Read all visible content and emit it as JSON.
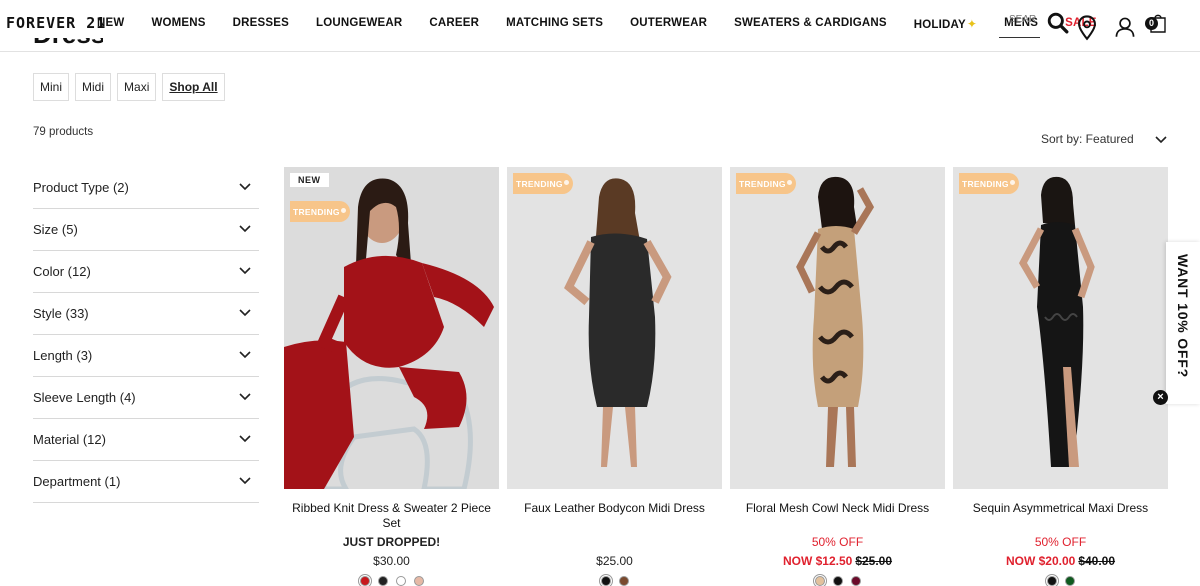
{
  "header": {
    "logo": "FOREVER 21",
    "nav": [
      {
        "label": "NEW"
      },
      {
        "label": "WOMENS"
      },
      {
        "label": "DRESSES"
      },
      {
        "label": "LOUNGEWEAR"
      },
      {
        "label": "CAREER"
      },
      {
        "label": "MATCHING SETS"
      },
      {
        "label": "OUTERWEAR"
      },
      {
        "label": "SWEATERS & CARDIGANS"
      },
      {
        "label": "HOLIDAY"
      },
      {
        "label": "MENS"
      },
      {
        "label": "SALE"
      }
    ],
    "search_placeholder": "SEAR",
    "cart_count": "0"
  },
  "page": {
    "title": "Dresses",
    "chips": [
      "Mini",
      "Midi",
      "Maxi",
      "Shop All"
    ],
    "product_count": "79 products",
    "sort_label": "Sort by: Featured"
  },
  "filters": [
    {
      "label": "Product Type (2)"
    },
    {
      "label": "Size (5)"
    },
    {
      "label": "Color (12)"
    },
    {
      "label": "Style (33)"
    },
    {
      "label": "Length (3)"
    },
    {
      "label": "Sleeve Length (4)"
    },
    {
      "label": "Material (12)"
    },
    {
      "label": "Department (1)"
    }
  ],
  "products": [
    {
      "name": "Ribbed Knit Dress & Sweater 2 Piece Set",
      "badge_new": "NEW",
      "badge_trend": "TRENDING",
      "promo": "JUST DROPPED!",
      "price": "$30.00",
      "swatches": [
        "#c8181d",
        "#222222",
        "#ffffff",
        "#e6b9a6"
      ]
    },
    {
      "name": "Faux Leather Bodycon Midi Dress",
      "badge_trend": "TRENDING",
      "promo": "",
      "price": "$25.00",
      "swatches": [
        "#111111",
        "#7a4a2e"
      ]
    },
    {
      "name": "Floral Mesh Cowl Neck Midi Dress",
      "badge_trend": "TRENDING",
      "promo": "50% OFF",
      "now": "NOW $12.50",
      "was": "$25.00",
      "swatches": [
        "#e3c29e",
        "#111111",
        "#6b0a2a"
      ]
    },
    {
      "name": "Sequin Asymmetrical Maxi Dress",
      "badge_trend": "TRENDING",
      "promo": "50% OFF",
      "now": "NOW $20.00",
      "was": "$40.00",
      "swatches": [
        "#111111",
        "#0f5a1f"
      ]
    }
  ],
  "promo_tab": "WANT 10% OFF?"
}
